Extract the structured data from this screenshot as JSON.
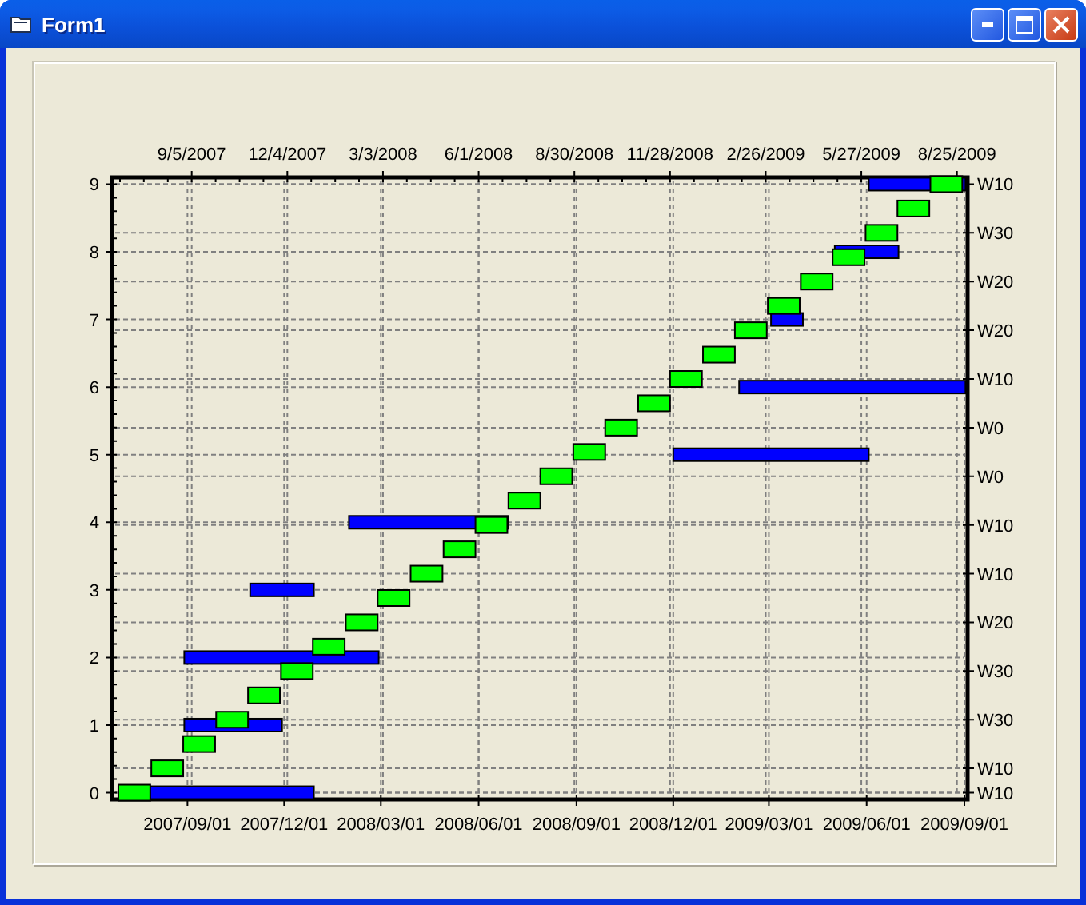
{
  "window": {
    "title": "Form1"
  },
  "chart": {
    "top_axis_labels": [
      "9/5/2007",
      "12/4/2007",
      "3/3/2008",
      "6/1/2008",
      "8/30/2008",
      "11/28/2008",
      "2/26/2009",
      "5/27/2009",
      "8/25/2009"
    ],
    "left_axis_labels": [
      "9",
      "8",
      "7",
      "6",
      "5",
      "4",
      "3",
      "2",
      "1",
      "0"
    ],
    "right_axis_labels": [
      "W10",
      "W30",
      "W20",
      "W20",
      "W10",
      "W0",
      "W0",
      "W10",
      "W10",
      "W20",
      "W30",
      "W30",
      "W10",
      "W10"
    ],
    "bottom_axis_labels": [
      "2007/09/01",
      "2007/12/01",
      "2008/03/01",
      "2008/06/01",
      "2008/09/01",
      "2008/12/01",
      "2009/03/01",
      "2009/06/01",
      "2009/09/01"
    ]
  }
}
